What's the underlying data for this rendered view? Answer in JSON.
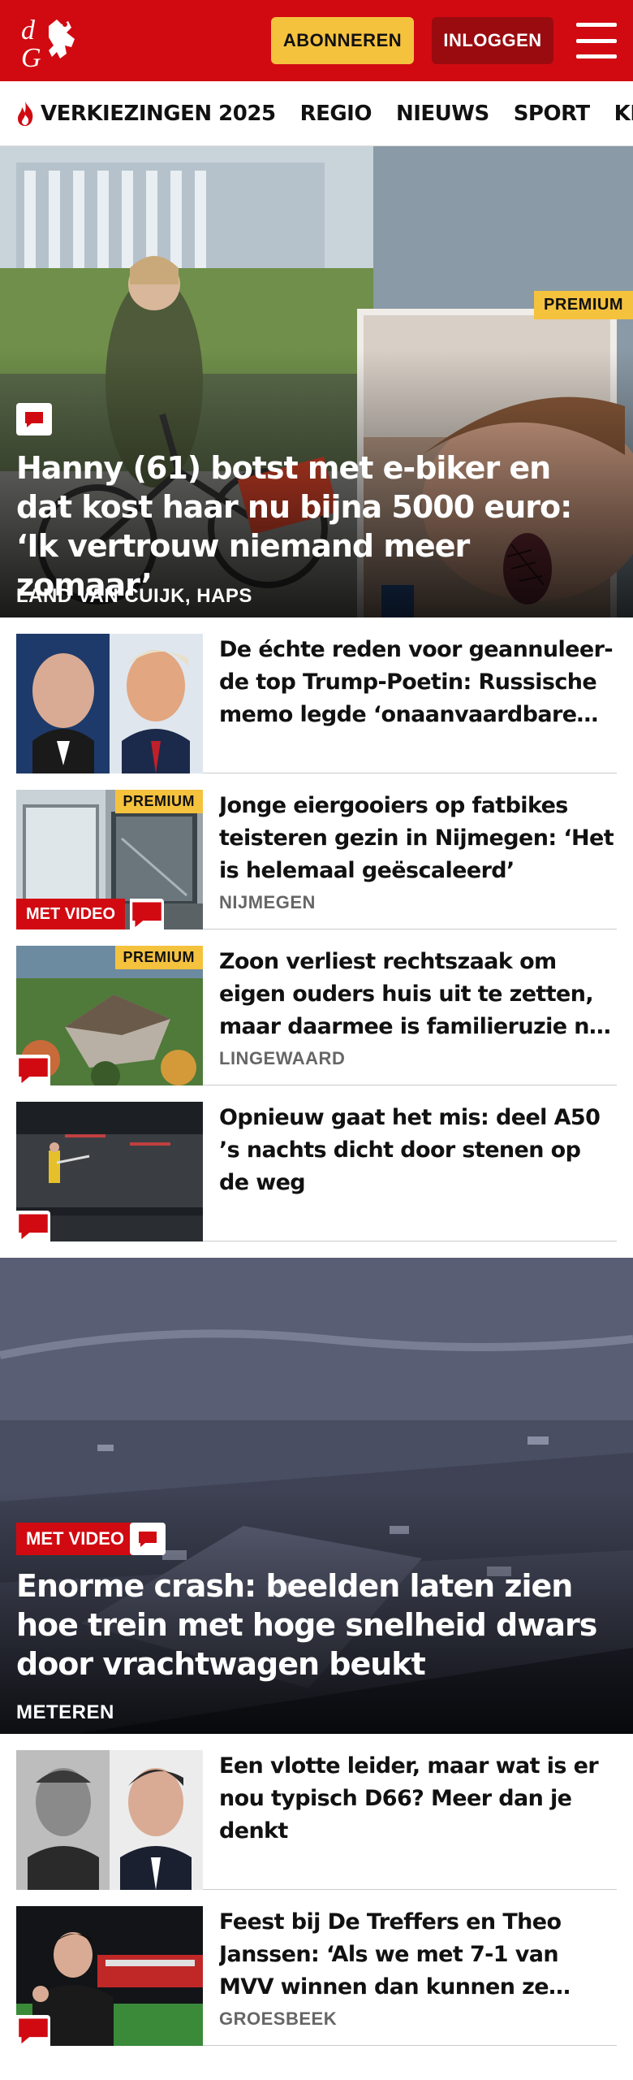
{
  "header": {
    "logo_letters": "dG",
    "subscribe_label": "ABONNEREN",
    "login_label": "INLOGGEN",
    "brand_color": "#d10a11",
    "subscribe_color": "#f5c23e"
  },
  "nav": {
    "items": [
      "VERKIEZINGEN 2025",
      "REGIO",
      "NIEUWS",
      "SPORT",
      "KIJK"
    ],
    "first_item_icon": "flame-icon"
  },
  "hero": {
    "badge": "PREMIUM",
    "title": "Hanny (61) botst met e-biker en dat kost haar nu bijna 5000 euro: ‘Ik vertrouw niemand meer zomaar’",
    "location": "LAND VAN CUIJK, HAPS",
    "has_comments": true
  },
  "articles": [
    {
      "title": "De échte reden voor geannuleer­de top Trump-Poetin: Russische memo legde ‘onaanvaardbare…",
      "location": "",
      "premium": false,
      "video": false,
      "comments": false
    },
    {
      "title": "Jonge eiergooiers op fatbikes teisteren gezin in Nijmegen: ‘Het is helemaal geëscaleerd’",
      "location": "NIJMEGEN",
      "premium": true,
      "badge": "PREMIUM",
      "video": true,
      "video_label": "MET VIDEO",
      "comments": true
    },
    {
      "title": "Zoon verliest rechtszaak om eigen ouders huis uit te zetten, maar daarmee is familieruzie n…",
      "location": "LINGEWAARD",
      "premium": true,
      "badge": "PREMIUM",
      "video": false,
      "comments": true
    },
    {
      "title": "Opnieuw gaat het mis: deel A50 ’s nachts dicht door stenen op de weg",
      "location": "",
      "premium": false,
      "video": false,
      "comments": true
    }
  ],
  "feature": {
    "video_label": "MET VIDEO",
    "title": "Enorme crash: beelden laten zien hoe trein met hoge snelheid dwars door vrachtwagen beukt",
    "location": "METEREN",
    "has_comments": true
  },
  "articles2": [
    {
      "title": "Een vlotte leider, maar wat is er nou typisch D66? Meer dan je denkt",
      "location": "",
      "comments": false
    },
    {
      "title": "Feest bij De Treffers en Theo Janssen: ‘Als we met 7-1 van MVV winnen dan kunnen ze niks…",
      "location": "GROESBEEK",
      "comments": true
    }
  ]
}
